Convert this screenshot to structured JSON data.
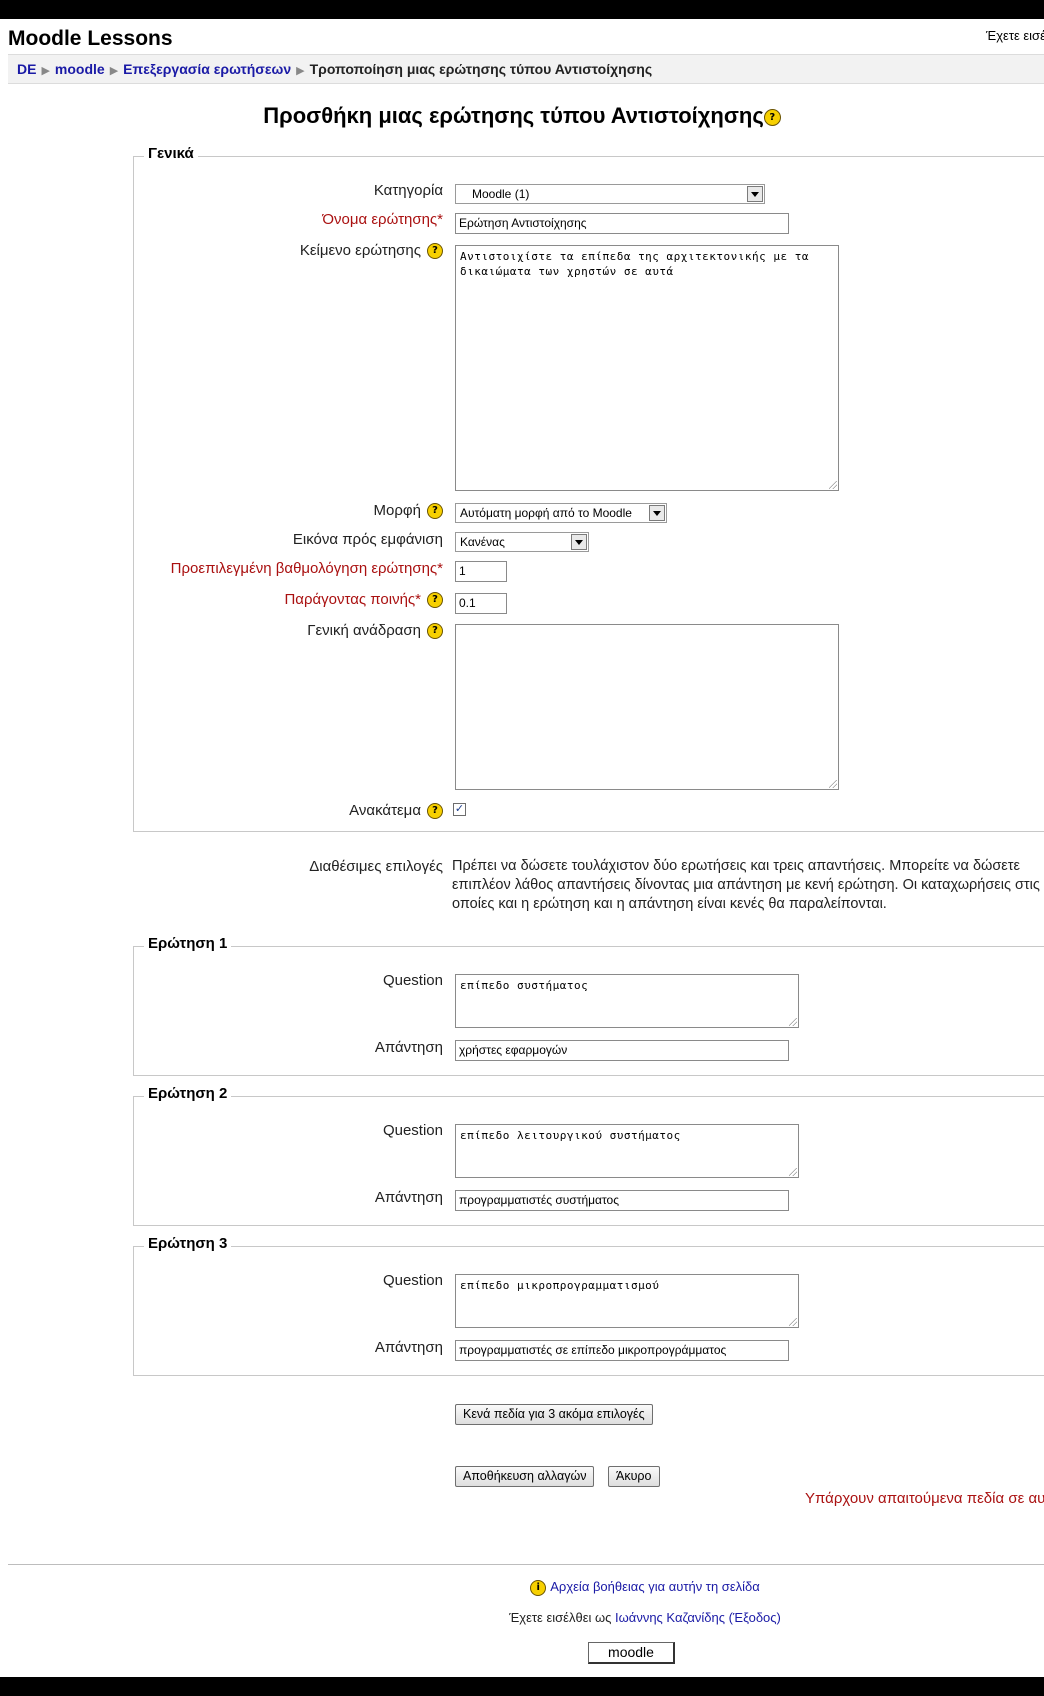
{
  "header": {
    "site_title": "Moodle Lessons",
    "login_info": "Έχετε εισέ"
  },
  "breadcrumb": {
    "items": [
      "DE",
      "moodle",
      "Επεξεργασία ερωτήσεων"
    ],
    "current": "Τροποποίηση μιας ερώτησης τύπου Αντιστοίχησης"
  },
  "page": {
    "heading": "Προσθήκη μιας ερώτησης τύπου Αντιστοίχησης"
  },
  "general": {
    "legend": "Γενικά",
    "category_label": "Κατηγορία",
    "category_value": "Moodle (1)",
    "name_label": "Όνομα ερώτησης*",
    "name_value": "Ερώτηση Αντιστοίχησης",
    "text_label": "Κείμενο ερώτησης",
    "text_value": "Αντιστοιχίστε τα επίπεδα της αρχιτεκτονικής με τα δικαιώματα των χρηστών σε αυτά",
    "format_label": "Μορφή",
    "format_value": "Αυτόματη μορφή από το Moodle",
    "image_label": "Εικόνα πρός εμφάνιση",
    "image_value": "Κανένας",
    "grade_label": "Προεπιλεγμένη βαθμολόγηση ερώτησης*",
    "grade_value": "1",
    "penalty_label": "Παράγοντας ποινής*",
    "penalty_value": "0.1",
    "feedback_label": "Γενική ανάδραση",
    "feedback_value": "",
    "shuffle_label": "Ανακάτεμα",
    "shuffle_checked": true
  },
  "available": {
    "label": "Διαθέσιμες επιλογές",
    "text": "Πρέπει να δώσετε τουλάχιστον δύο ερωτήσεις και τρεις απαντήσεις. Μπορείτε να δώσετε επιπλέον λάθος απαντήσεις δίνοντας μια απάντηση με κενή ερώτηση. Οι καταχωρήσεις στις οποίες και η ερώτηση και η απάντηση είναι κενές θα παραλείπονται."
  },
  "questions": [
    {
      "legend": "Ερώτηση 1",
      "question_label": "Question",
      "question_value": "επίπεδο συστήματος",
      "answer_label": "Απάντηση",
      "answer_value": "χρήστες εφαρμογών"
    },
    {
      "legend": "Ερώτηση 2",
      "question_label": "Question",
      "question_value": "επίπεδο λειτουργικού συστήματος",
      "answer_label": "Απάντηση",
      "answer_value": "προγραμματιστές συστήματος"
    },
    {
      "legend": "Ερώτηση 3",
      "question_label": "Question",
      "question_value": "επίπεδο μικροπρογραμματισμού",
      "answer_label": "Απάντηση",
      "answer_value": "προγραμματιστές σε επίπεδο μικροπρογράμματος"
    }
  ],
  "buttons": {
    "add_blanks": "Κενά πεδία για 3 ακόμα επιλογές",
    "save": "Αποθήκευση αλλαγών",
    "cancel": "Άκυρο"
  },
  "required_note": "Υπάρχουν απαιτούμενα πεδία σε αυ",
  "footer": {
    "help_link": "Αρχεία βοήθειας για αυτήν τη σελίδα",
    "logged_in_prefix": "Έχετε εισέλθει ως",
    "user_name": "Ιωάννης Καζανίδης",
    "logout": "(Έξοδος)",
    "home_button": "moodle"
  },
  "icons": {
    "help": "help-icon",
    "breadcrumb_separator": "triangle-right-icon",
    "dropdown": "chevron-down-icon"
  },
  "colors": {
    "link": "#1a1aa6",
    "required": "#aa1111",
    "help_icon": "#f7d000"
  }
}
